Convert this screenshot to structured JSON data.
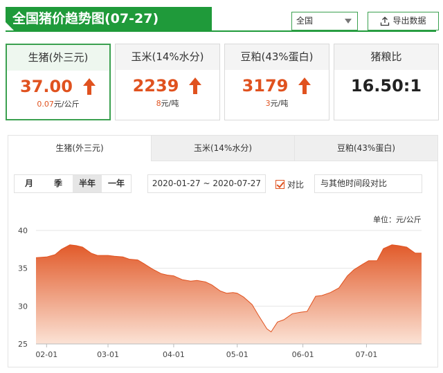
{
  "header": {
    "title": "全国猪价趋势图(07-27)",
    "region": "全国",
    "export_label": "导出数据"
  },
  "cards": [
    {
      "name": "生猪(外三元)",
      "value": "37.00",
      "change": "0.07",
      "unit": "元/公斤",
      "trend": "up",
      "active": true
    },
    {
      "name": "玉米(14%水分)",
      "value": "2239",
      "change": "8",
      "unit": "元/吨",
      "trend": "up",
      "active": false
    },
    {
      "name": "豆粕(43%蛋白)",
      "value": "3179",
      "change": "3",
      "unit": "元/吨",
      "trend": "up",
      "active": false
    },
    {
      "name": "猪粮比",
      "value": "16.50:1",
      "change": "",
      "unit": "",
      "trend": "",
      "active": false
    }
  ],
  "tabs": [
    {
      "label": "生猪(外三元)",
      "active": true
    },
    {
      "label": "玉米(14%水分)",
      "active": false
    },
    {
      "label": "豆粕(43%蛋白)",
      "active": false
    }
  ],
  "controls": {
    "periods": [
      "月",
      "季",
      "半年",
      "一年"
    ],
    "selected_period": "半年",
    "date_range": "2020-01-27 ~ 2020-07-27",
    "compare_label": "对比",
    "compare_checked": true,
    "compare_placeholder": "与其他时间段对比"
  },
  "colors": {
    "brand_green": "#1f9a3a",
    "accent_orange": "#e0521f",
    "fill_top": "#e0521f",
    "fill_bottom": "#fbe1d3"
  },
  "chart_data": {
    "type": "area",
    "unit_label": "单位：元/公斤",
    "ylim": [
      25,
      40
    ],
    "yticks": [
      25,
      30,
      35,
      40
    ],
    "xticks": [
      "02-01",
      "03-01",
      "04-01",
      "05-01",
      "06-01",
      "07-01"
    ],
    "grid": true,
    "x": [
      "01-27",
      "02-01",
      "02-05",
      "02-08",
      "02-12",
      "02-15",
      "02-18",
      "02-22",
      "02-25",
      "03-01",
      "03-04",
      "03-08",
      "03-11",
      "03-15",
      "03-18",
      "03-22",
      "03-26",
      "03-29",
      "04-01",
      "04-05",
      "04-09",
      "04-12",
      "04-16",
      "04-19",
      "04-23",
      "04-26",
      "04-29",
      "05-01",
      "05-04",
      "05-08",
      "05-11",
      "05-15",
      "05-17",
      "05-20",
      "05-23",
      "05-27",
      "05-31",
      "06-03",
      "06-07",
      "06-10",
      "06-14",
      "06-18",
      "06-22",
      "06-25",
      "06-29",
      "07-02",
      "07-06",
      "07-09",
      "07-13",
      "07-16",
      "07-20",
      "07-24",
      "07-27"
    ],
    "series": [
      {
        "values": [
          36.4,
          36.5,
          36.8,
          37.5,
          38.1,
          38.0,
          37.8,
          37.0,
          36.7,
          36.7,
          36.6,
          36.5,
          36.2,
          36.1,
          35.6,
          34.9,
          34.3,
          34.1,
          34.0,
          33.5,
          33.3,
          33.4,
          33.2,
          32.8,
          32.0,
          31.7,
          31.8,
          31.7,
          31.2,
          30.2,
          28.8,
          27.0,
          26.6,
          27.9,
          28.2,
          29.0,
          29.2,
          29.3,
          31.3,
          31.4,
          31.8,
          32.4,
          34.0,
          34.8,
          35.5,
          36.0,
          36.0,
          37.6,
          38.1,
          38.0,
          37.8,
          37.0,
          37.0
        ]
      }
    ]
  }
}
